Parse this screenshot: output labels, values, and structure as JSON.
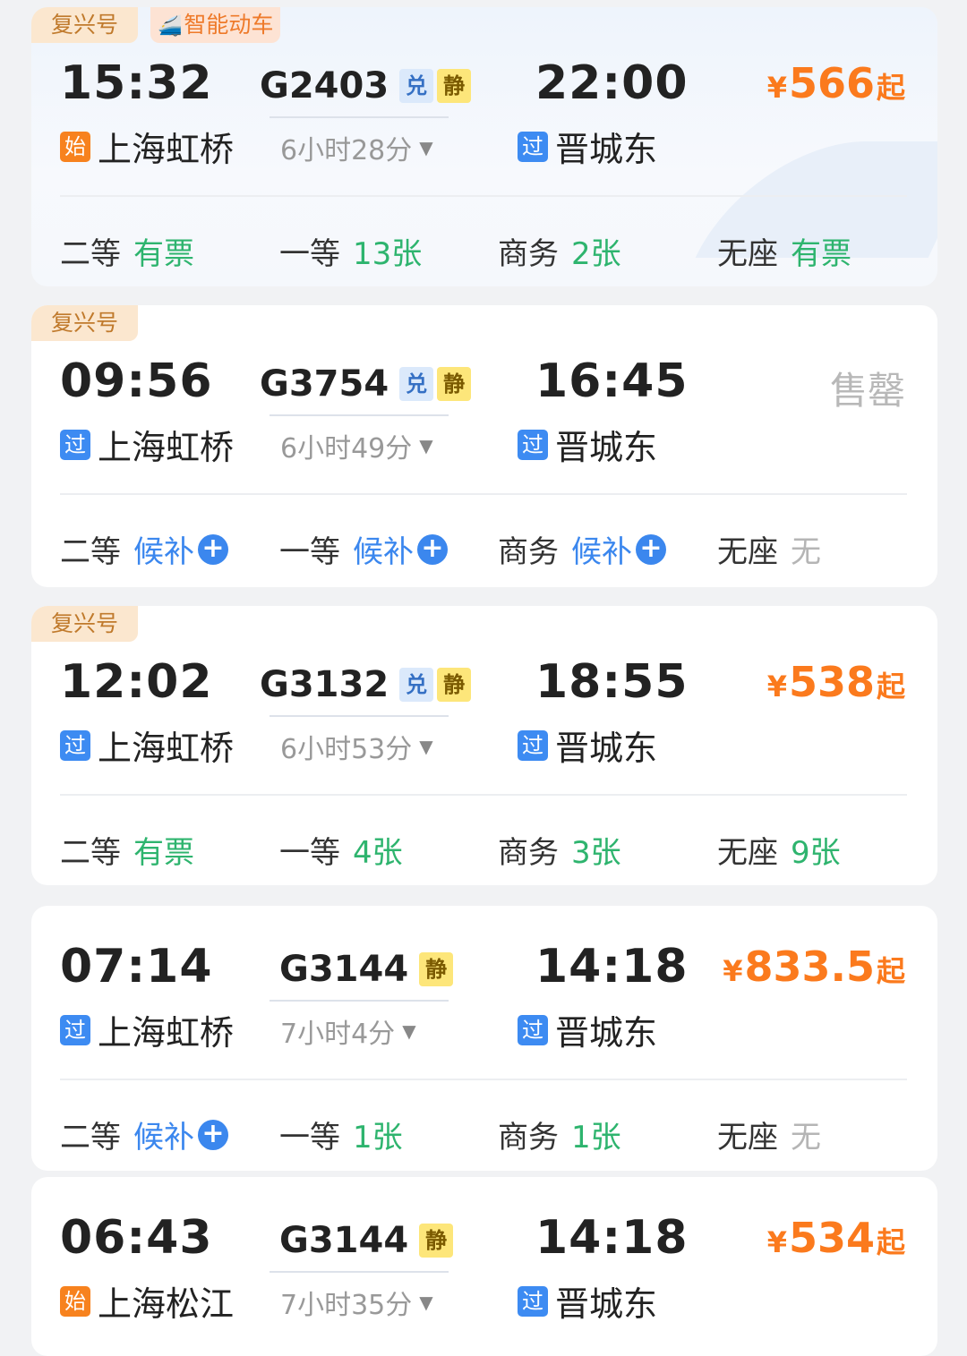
{
  "labels": {
    "badge_pass": "过",
    "badge_start": "始",
    "mini_dui": "兑",
    "mini_jing": "静",
    "yen": "¥",
    "qi": "起",
    "caret": "▼",
    "plus": "+",
    "soldout": "售罄"
  },
  "trains": [
    {
      "tags": [
        "复兴号",
        "智能动车"
      ],
      "depart_time": "15:32",
      "depart_station": "上海虹桥",
      "depart_type": "start",
      "train_no": "G2403",
      "has_dui": true,
      "duration": "6小时28分",
      "arrive_time": "22:00",
      "arrive_station": "晋城东",
      "price": "566",
      "soldout": false,
      "seats": [
        {
          "class": "二等",
          "value": "有票",
          "style": "green"
        },
        {
          "class": "一等",
          "value": "13张",
          "style": "green"
        },
        {
          "class": "商务",
          "value": "2张",
          "style": "green"
        },
        {
          "class": "无座",
          "value": "有票",
          "style": "green"
        }
      ]
    },
    {
      "tags": [
        "复兴号"
      ],
      "depart_time": "09:56",
      "depart_station": "上海虹桥",
      "depart_type": "pass",
      "train_no": "G3754",
      "has_dui": true,
      "duration": "6小时49分",
      "arrive_time": "16:45",
      "arrive_station": "晋城东",
      "price": "",
      "soldout": true,
      "seats": [
        {
          "class": "二等",
          "value": "候补",
          "style": "blue"
        },
        {
          "class": "一等",
          "value": "候补",
          "style": "blue"
        },
        {
          "class": "商务",
          "value": "候补",
          "style": "blue"
        },
        {
          "class": "无座",
          "value": "无",
          "style": "gray"
        }
      ]
    },
    {
      "tags": [
        "复兴号"
      ],
      "depart_time": "12:02",
      "depart_station": "上海虹桥",
      "depart_type": "pass",
      "train_no": "G3132",
      "has_dui": true,
      "duration": "6小时53分",
      "arrive_time": "18:55",
      "arrive_station": "晋城东",
      "price": "538",
      "soldout": false,
      "seats": [
        {
          "class": "二等",
          "value": "有票",
          "style": "green"
        },
        {
          "class": "一等",
          "value": "4张",
          "style": "green"
        },
        {
          "class": "商务",
          "value": "3张",
          "style": "green"
        },
        {
          "class": "无座",
          "value": "9张",
          "style": "green"
        }
      ]
    },
    {
      "tags": [],
      "depart_time": "07:14",
      "depart_station": "上海虹桥",
      "depart_type": "pass",
      "train_no": "G3144",
      "has_dui": false,
      "duration": "7小时4分",
      "arrive_time": "14:18",
      "arrive_station": "晋城东",
      "price": "833.5",
      "soldout": false,
      "seats": [
        {
          "class": "二等",
          "value": "候补",
          "style": "blue"
        },
        {
          "class": "一等",
          "value": "1张",
          "style": "green"
        },
        {
          "class": "商务",
          "value": "1张",
          "style": "green"
        },
        {
          "class": "无座",
          "value": "无",
          "style": "gray"
        }
      ]
    },
    {
      "tags": [],
      "depart_time": "06:43",
      "depart_station": "上海松江",
      "depart_type": "start",
      "train_no": "G3144",
      "has_dui": false,
      "duration": "7小时35分",
      "arrive_time": "14:18",
      "arrive_station": "晋城东",
      "price": "534",
      "soldout": false,
      "seats": []
    }
  ]
}
